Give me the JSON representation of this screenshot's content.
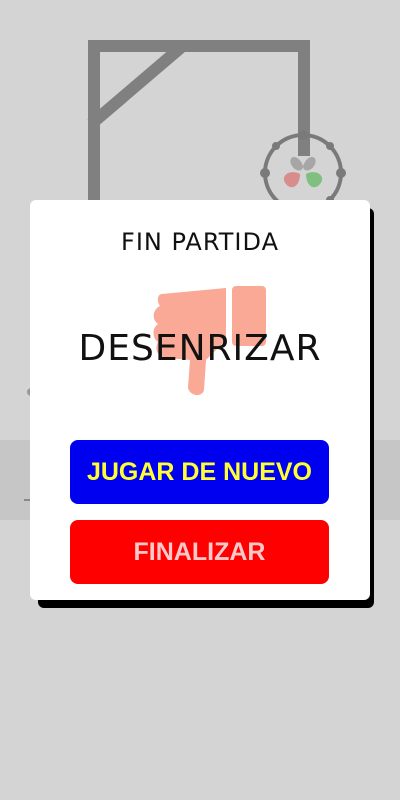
{
  "dialog": {
    "title": "FIN PARTIDA",
    "word": "DESENRIZAR",
    "retry_label": "JUGAR DE NUEVO",
    "finish_label": "FINALIZAR",
    "result_icon": "thumbs-down-icon"
  },
  "colors": {
    "background": "#d4d4d4",
    "gallows": "#808080",
    "retry_bg": "#0000f0",
    "retry_text": "#ffff33",
    "finish_bg": "#ff0000",
    "finish_text": "#ffc8c8",
    "thumb": "#f9a08a"
  }
}
